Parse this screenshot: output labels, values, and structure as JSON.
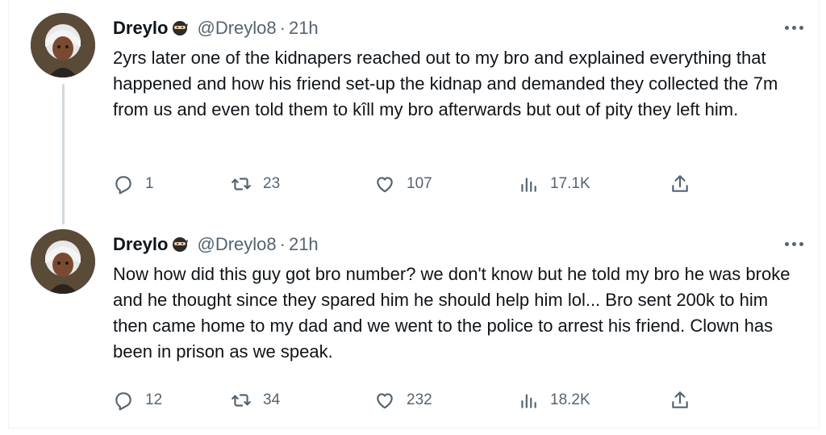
{
  "tweets": [
    {
      "author": {
        "name": "Dreylo",
        "name_emoji": "ninja-emoji",
        "handle": "@Dreylo8",
        "separator": "·",
        "time": "21h"
      },
      "text": "2yrs later one of the kidnapers reached out to my bro and explained everything that happened and how his friend set-up the kidnap and demanded they collected the 7m from us and even told them to kîll my bro afterwards but out of pity they left him.",
      "stats": {
        "replies": "1",
        "retweets": "23",
        "likes": "107",
        "views": "17.1K"
      }
    },
    {
      "author": {
        "name": "Dreylo",
        "name_emoji": "ninja-emoji",
        "handle": "@Dreylo8",
        "separator": "·",
        "time": "21h"
      },
      "text": "Now how did this guy got bro number? we don't know but he told my bro he was broke and he thought since they spared him he should help him lol... Bro sent 200k to him then came home to my dad and we went to the police to arrest his friend. Clown has been in prison as we speak.",
      "stats": {
        "replies": "12",
        "retweets": "34",
        "likes": "232",
        "views": "18.2K"
      }
    }
  ],
  "icons": {
    "reply": "speech-bubble-icon",
    "retweet": "retweet-arrows-icon",
    "like": "heart-icon",
    "views": "bar-chart-icon",
    "share": "upload-arrow-icon",
    "more": "three-dots-icon"
  },
  "colors": {
    "text": "#0f1419",
    "secondary": "#536471",
    "thread_line": "#cfd9de"
  }
}
